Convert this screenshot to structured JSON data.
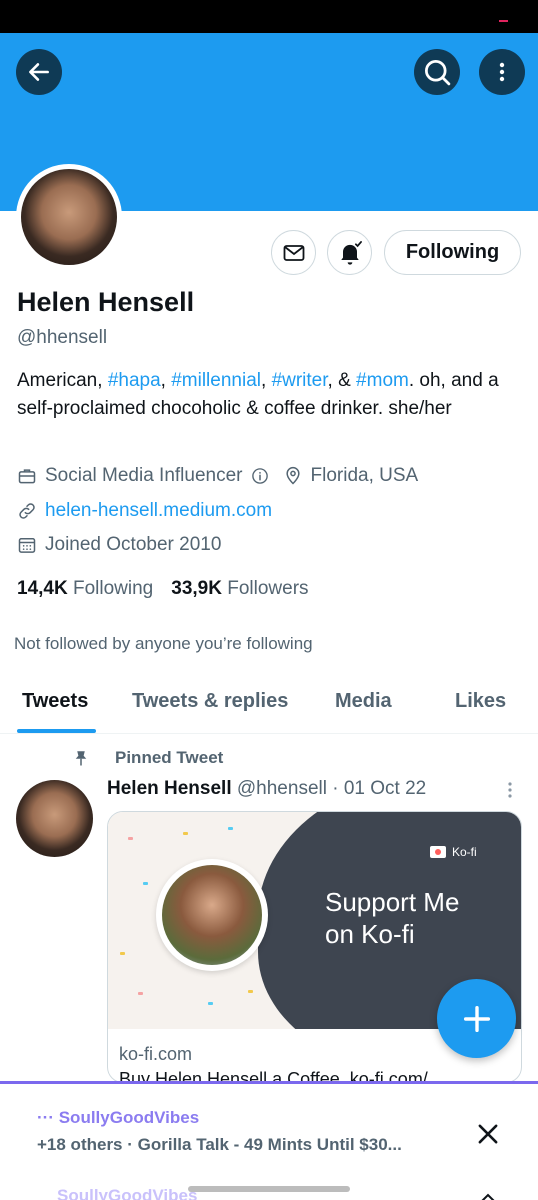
{
  "header": {
    "back_icon": "arrow-left-icon",
    "search_icon": "search-icon",
    "more_icon": "more-vertical-icon",
    "banner_color": "#1d9bf0"
  },
  "profile": {
    "name": "Helen Hensell",
    "handle": "@hhensell",
    "bio": {
      "p1": "American, ",
      "t1": "#hapa",
      "p2": ", ",
      "t2": "#millennial",
      "p3": ", ",
      "t3": "#writer",
      "p4": ", & ",
      "t4": "#mom",
      "p5": ". oh, and a self-proclaimed chocoholic & coffee drinker. she/her"
    },
    "category": "Social Media Influencer",
    "location": "Florida, USA",
    "website": "helen-hensell.medium.com",
    "joined": "Joined October 2010",
    "following_count": "14,4K",
    "following_label": "Following",
    "followers_count": "33,9K",
    "followers_label": "Followers",
    "not_followed": "Not followed by anyone you’re following"
  },
  "actions": {
    "message_icon": "mail-icon",
    "notify_icon": "bell-icon",
    "following_button": "Following"
  },
  "tabs": [
    {
      "label": "Tweets",
      "active": true
    },
    {
      "label": "Tweets & replies",
      "active": false
    },
    {
      "label": "Media",
      "active": false
    },
    {
      "label": "Likes",
      "active": false
    }
  ],
  "pinned_tweet": {
    "pinned_label": "Pinned Tweet",
    "author_name": "Helen Hensell",
    "author_meta": "@hhensell · 01 Oct 22",
    "card": {
      "brand": "Ko-fi",
      "headline_line1": "Support Me",
      "headline_line2": "on Ko-fi",
      "domain": "ko-fi.com",
      "description": "Buy Helen Hensell a Coffee. ko-fi.com/"
    }
  },
  "fab": {
    "icon": "plus-icon"
  },
  "media_notification": {
    "app": "SoullyGoodVibes",
    "info": "+18 others · Gorilla Talk - 49 Mints Until $30...",
    "close_icon": "close-icon",
    "peek_app": "SoullyGoodVibes"
  },
  "colors": {
    "accent": "#1d9bf0",
    "text_primary": "#0f1419",
    "text_secondary": "#536471",
    "media_accent": "#7b68ee"
  }
}
